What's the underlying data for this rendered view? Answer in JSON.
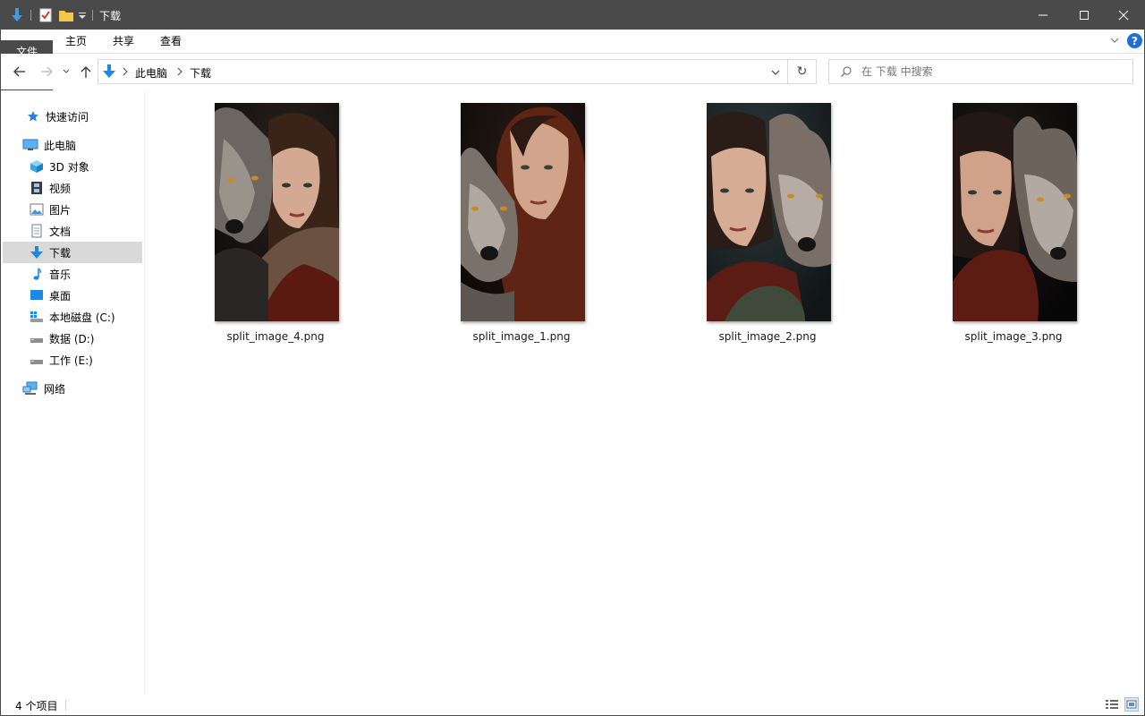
{
  "titlebar": {
    "title": "下载",
    "minimize": "—",
    "maximize": "☐",
    "close": "✕"
  },
  "ribbon": {
    "tabs": [
      "文件",
      "主页",
      "共享",
      "查看"
    ],
    "help": "?"
  },
  "address": {
    "crumbs": [
      "此电脑",
      "下载"
    ],
    "search_placeholder": "在 下载 中搜索"
  },
  "sidebar": {
    "items": [
      {
        "label": "快速访问",
        "icon": "star-icon"
      },
      {
        "label": "此电脑",
        "icon": "computer-icon"
      },
      {
        "label": "3D 对象",
        "icon": "cube-icon"
      },
      {
        "label": "视频",
        "icon": "film-icon"
      },
      {
        "label": "图片",
        "icon": "picture-icon"
      },
      {
        "label": "文档",
        "icon": "document-icon"
      },
      {
        "label": "下载",
        "icon": "download-arrow-icon",
        "selected": true
      },
      {
        "label": "音乐",
        "icon": "music-note-icon"
      },
      {
        "label": "桌面",
        "icon": "desktop-icon"
      },
      {
        "label": "本地磁盘 (C:)",
        "icon": "windows-drive-icon"
      },
      {
        "label": "数据 (D:)",
        "icon": "drive-icon"
      },
      {
        "label": "工作 (E:)",
        "icon": "drive-icon"
      },
      {
        "label": "网络",
        "icon": "network-icon"
      }
    ]
  },
  "files": [
    {
      "name": "split_image_4.png"
    },
    {
      "name": "split_image_1.png"
    },
    {
      "name": "split_image_2.png"
    },
    {
      "name": "split_image_3.png"
    }
  ],
  "status": {
    "item_count": "4 个项目"
  },
  "colors": {
    "titlebar": "#4a4a4a",
    "selection": "#d9d9d9",
    "accent_blue": "#1e88e5"
  }
}
